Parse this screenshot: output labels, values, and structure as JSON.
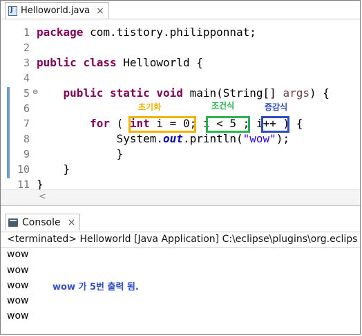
{
  "editor_tab": {
    "title": "Helloworld.java",
    "close_glyph": "×",
    "icon": "java-file-icon"
  },
  "code": {
    "line_numbers": [
      "1",
      "2",
      "3",
      "4",
      "5",
      "6",
      "7",
      "8",
      "9",
      "10",
      "11"
    ],
    "fold_glyph": "⊖",
    "l1": {
      "kw": "package",
      "rest": " com.tistory.philipponnat;"
    },
    "l3": {
      "kw1": "public",
      "kw2": "class",
      "rest": " Helloworld {"
    },
    "l5": {
      "kw1": "public",
      "kw2": "static",
      "kw3": "void",
      "mid": " main(String[] ",
      "param": "args",
      "end": ") {"
    },
    "l7": {
      "kw_for": "for",
      "open": " ( ",
      "kw_int": "int",
      "init_rest": " i = 0",
      "semi1": ";",
      "cond": "i < 5",
      "semi2": ";",
      "incr": "i++",
      "close": ") {"
    },
    "l8": {
      "pre": "System.",
      "field": "out",
      "mid": ".println(",
      "str": "\"wow\"",
      "end": ");"
    },
    "l9": "}",
    "l10": "}",
    "l11": "}"
  },
  "annotations": {
    "init_label": "초기화",
    "cond_label": "조건식",
    "incr_label": "증감식",
    "colors": {
      "init": "#f0b400",
      "cond": "#2db050",
      "incr": "#2f4ac0"
    }
  },
  "console": {
    "tab_label": "Console",
    "close_glyph": "×",
    "icon": "console-icon",
    "status": "<terminated> Helloworld [Java Application] C:\\eclipse\\plugins\\org.eclips",
    "output": [
      "wow",
      "wow",
      "wow",
      "wow",
      "wow"
    ],
    "note": "wow 가 5번 출력 됨."
  },
  "horizontal_scroll_arrow": "<"
}
